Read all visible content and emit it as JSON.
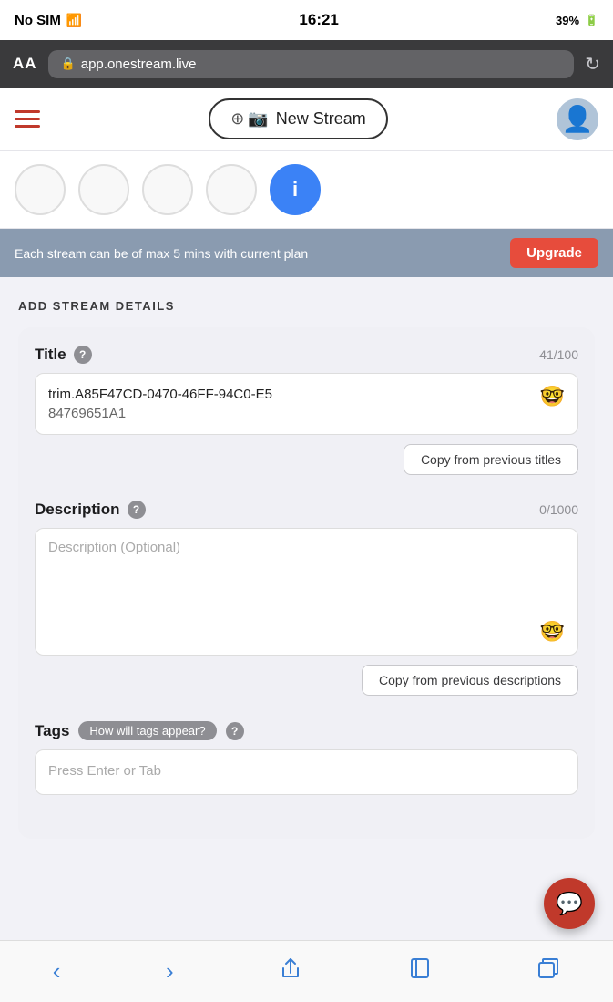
{
  "statusBar": {
    "carrier": "No SIM",
    "time": "16:21",
    "battery": "39%"
  },
  "browserBar": {
    "aa": "AA",
    "url": "app.onestream.live"
  },
  "header": {
    "newStreamLabel": "New Stream"
  },
  "upgradeBanner": {
    "message": "Each stream can be of max 5 mins with current plan",
    "buttonLabel": "Upgrade"
  },
  "sectionTitle": "ADD STREAM DETAILS",
  "titleField": {
    "label": "Title",
    "charCount": "41/100",
    "value1": "trim.A85F47CD-0470-46FF-94C0-E5",
    "value2": "84769651A1",
    "copyBtn": "Copy from previous titles"
  },
  "descriptionField": {
    "label": "Description",
    "charCount": "0/1000",
    "placeholder": "Description (Optional)",
    "copyBtn": "Copy from previous descriptions"
  },
  "tagsField": {
    "label": "Tags",
    "badgeLabel": "How will tags appear?",
    "placeholder": "Press Enter or Tab"
  },
  "navButtons": {
    "back": "‹",
    "forward": "›",
    "share": "↑",
    "book": "📖",
    "tabs": "⧉"
  }
}
